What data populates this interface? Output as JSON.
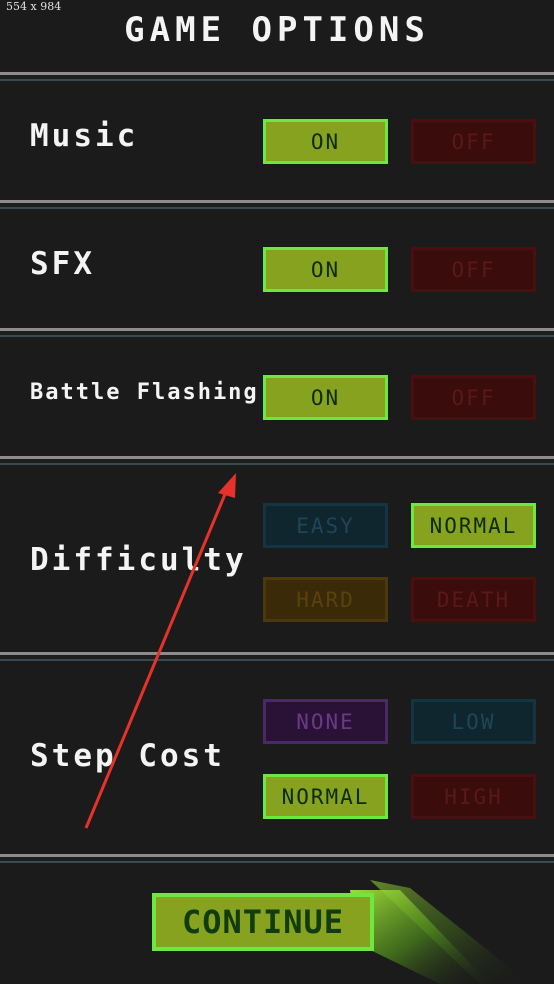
{
  "screenshot_label": "554 x 984",
  "title": "GAME OPTIONS",
  "rows": {
    "music": {
      "label": "Music",
      "on": "ON",
      "off": "OFF"
    },
    "sfx": {
      "label": "SFX",
      "on": "ON",
      "off": "OFF"
    },
    "battle_flashing": {
      "label": "Battle Flashing",
      "on": "ON",
      "off": "OFF"
    },
    "difficulty": {
      "label": "Difficulty",
      "easy": "EASY",
      "normal": "NORMAL",
      "hard": "HARD",
      "death": "DEATH",
      "selected": "NORMAL"
    },
    "step_cost": {
      "label": "Step Cost",
      "none": "NONE",
      "low": "LOW",
      "normal": "NORMAL",
      "high": "HIGH",
      "selected": "NORMAL"
    }
  },
  "continue_label": "CONTINUE",
  "colors": {
    "background": "#1b1b1b",
    "selected_fill": "#86a21f",
    "selected_border": "#6de840",
    "annotation_arrow": "#e8312a"
  },
  "icons": [
    "annotation-arrow"
  ]
}
